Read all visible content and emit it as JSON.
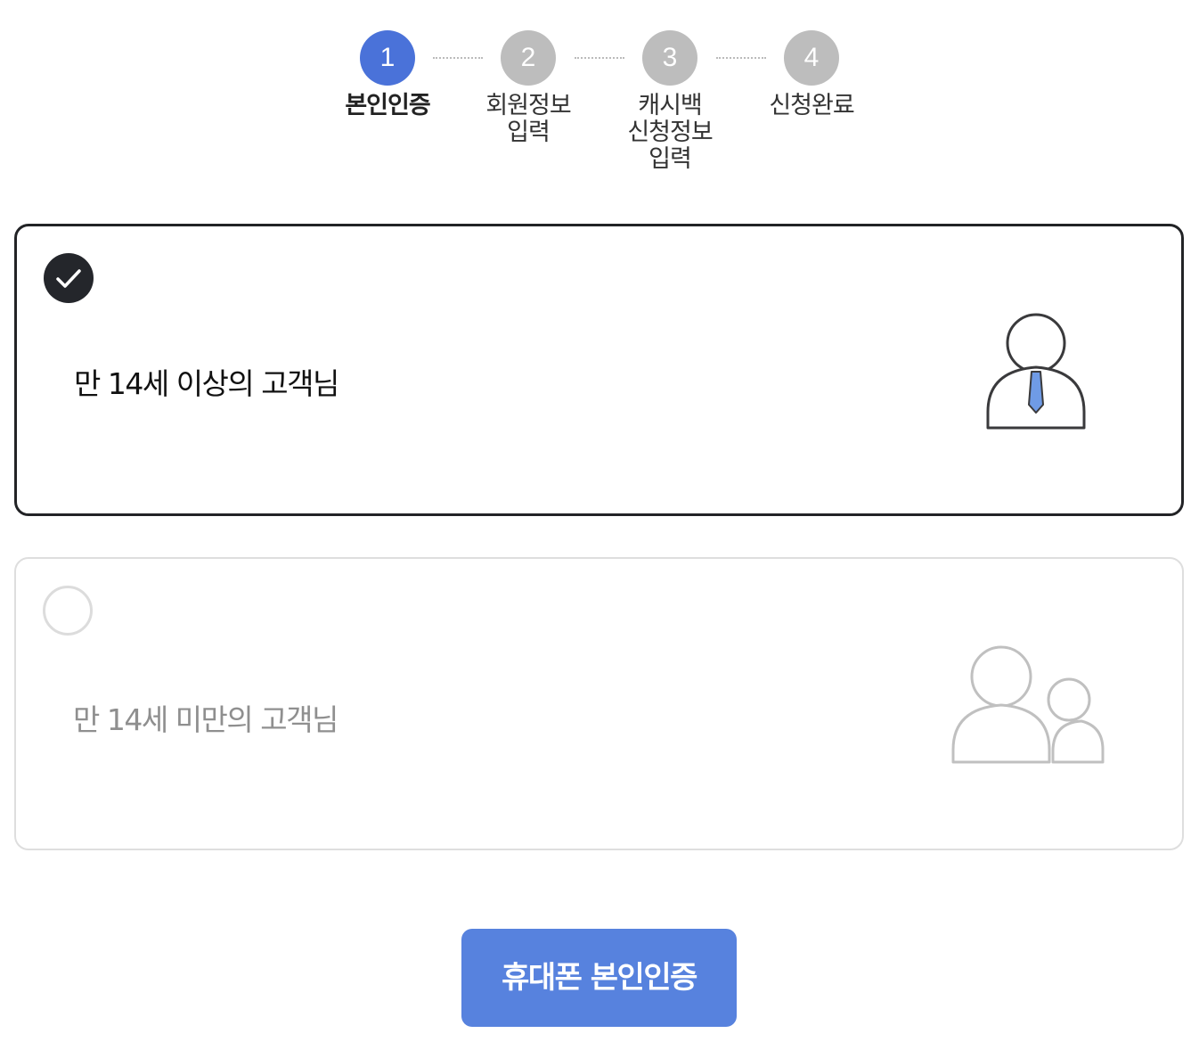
{
  "stepper": {
    "steps": [
      {
        "number": "1",
        "label": "본인인증",
        "state": "active"
      },
      {
        "number": "2",
        "label": "회원정보\n입력",
        "state": "inactive"
      },
      {
        "number": "3",
        "label": "캐시백\n신청정보\n입력",
        "state": "inactive"
      },
      {
        "number": "4",
        "label": "신청완료",
        "state": "inactive"
      }
    ]
  },
  "options": [
    {
      "label": "만 14세 이상의 고객님",
      "selected": true,
      "icon": "adult-person-icon"
    },
    {
      "label": "만 14세 미만의 고객님",
      "selected": false,
      "icon": "adult-child-icon"
    }
  ],
  "cta": {
    "label": "휴대폰 본인인증"
  },
  "colors": {
    "accent": "#4a72d9",
    "button": "#5782de",
    "inactive_step": "#bdbdbd",
    "selected_border": "#222326",
    "tie": "#6f9be6"
  }
}
